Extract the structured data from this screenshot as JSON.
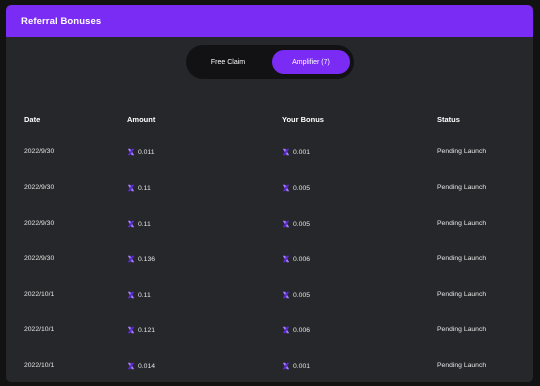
{
  "header": {
    "title": "Referral Bonuses"
  },
  "tabs": [
    {
      "label": "Free Claim",
      "active": false
    },
    {
      "label": "Amplifier (7)",
      "active": true
    }
  ],
  "columns": {
    "date": "Date",
    "amount": "Amount",
    "bonus": "Your Bonus",
    "status": "Status"
  },
  "rows": [
    {
      "date": "2022/9/30",
      "amount": "0.011",
      "bonus": "0.001",
      "status": "Pending Launch"
    },
    {
      "date": "2022/9/30",
      "amount": "0.11",
      "bonus": "0.005",
      "status": "Pending Launch"
    },
    {
      "date": "2022/9/30",
      "amount": "0.11",
      "bonus": "0.005",
      "status": "Pending Launch"
    },
    {
      "date": "2022/9/30",
      "amount": "0.136",
      "bonus": "0.006",
      "status": "Pending Launch"
    },
    {
      "date": "2022/10/1",
      "amount": "0.11",
      "bonus": "0.005",
      "status": "Pending Launch"
    },
    {
      "date": "2022/10/1",
      "amount": "0.121",
      "bonus": "0.006",
      "status": "Pending Launch"
    },
    {
      "date": "2022/10/1",
      "amount": "0.014",
      "bonus": "0.001",
      "status": "Pending Launch"
    }
  ],
  "icons": {
    "token": "x-token-icon"
  },
  "colors": {
    "accent": "#7a2cf5",
    "panel": "#26272a",
    "background": "#121212",
    "icon_light": "#a77bff",
    "icon_dark": "#5b2bd6"
  }
}
